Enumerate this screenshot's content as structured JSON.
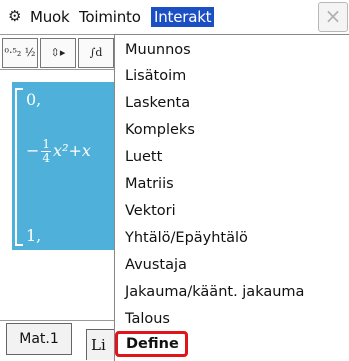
{
  "menubar": {
    "gear_icon": "gear-icon",
    "items": [
      "Muok",
      "Toiminto",
      "Interakt"
    ],
    "active_index": 2,
    "close_glyph": "×"
  },
  "toolbar": {
    "buttons": [
      {
        "label": "⁰·⁵₂ ½",
        "icon": "fraction-decimal-icon"
      },
      {
        "label": "⇳▸",
        "icon": "simplify-icon"
      },
      {
        "label": "∫d",
        "icon": "integral-icon"
      }
    ]
  },
  "matrix": {
    "row1": "0,",
    "row2_prefix": "−",
    "row2_frac_num": "1",
    "row2_frac_den": "4",
    "row2_rest": "x²+x",
    "row3": "1,"
  },
  "dropdown": {
    "items": [
      "Muunnos",
      "Lisätoim",
      "Laskenta",
      "Kompleks",
      "Luett",
      "Matriis",
      "Vektori",
      "Yhtälö/Epäyhtälö",
      "Avustaja",
      "Jakauma/käänt. jakauma",
      "Talous",
      "Define"
    ],
    "highlighted": "Define"
  },
  "bottom": {
    "tab_mat": "Mat.1",
    "tab_lin": "Li"
  },
  "colors": {
    "menu_active": "#1b4fc4",
    "matrix_bg": "#4fb0da",
    "highlight_border": "#e0141b"
  }
}
